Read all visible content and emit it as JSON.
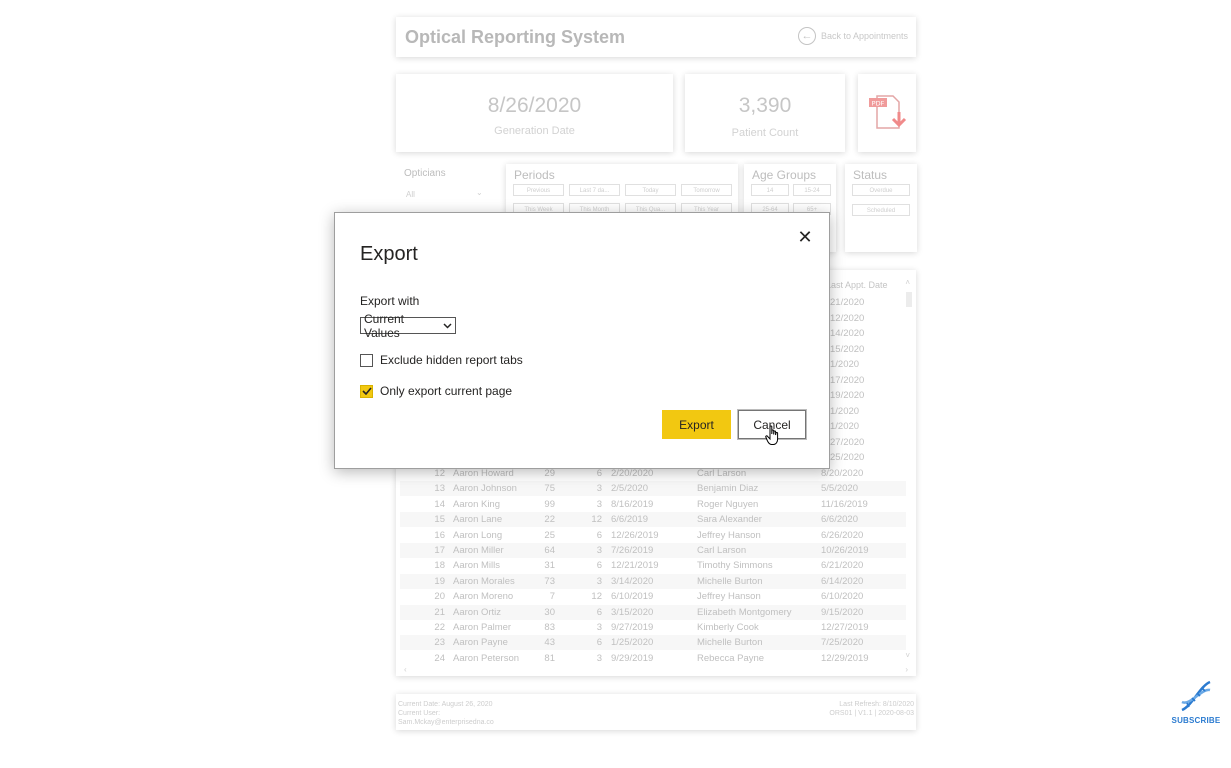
{
  "report": {
    "title": "Optical Reporting System",
    "back_label": "Back to Appointments",
    "kpi_generation": {
      "value": "8/26/2020",
      "label": "Generation Date"
    },
    "kpi_patients": {
      "value": "3,390",
      "label": "Patient Count"
    },
    "pdf_badge": "PDF",
    "slicers": {
      "opticians": {
        "title": "Opticians",
        "value": "All"
      },
      "periods": {
        "title": "Periods",
        "options": [
          "Previous",
          "Last 7 da...",
          "Today",
          "Tomorrow",
          "This Week",
          "This Month",
          "This Qua...",
          "This Year"
        ]
      },
      "age_groups": {
        "title": "Age Groups",
        "options": [
          "14",
          "15-24",
          "25-64",
          "65+"
        ]
      },
      "status": {
        "title": "Status",
        "options": [
          "Overdue",
          "Scheduled"
        ]
      }
    },
    "table": {
      "last_appt_header": "Last Appt. Date",
      "hidden_last_dates": [
        "21/2020",
        "12/2020",
        "14/2020",
        "15/2020",
        "1/2020",
        "17/2020",
        "19/2020",
        "1/2020",
        "1/2020",
        "27/2020",
        "25/2020"
      ],
      "rows": [
        {
          "id": "12",
          "name": "Aaron Howard",
          "age": "29",
          "period": "6",
          "date": "2/20/2020",
          "optician": "Carl Larson",
          "last": "8/20/2020"
        },
        {
          "id": "13",
          "name": "Aaron Johnson",
          "age": "75",
          "period": "3",
          "date": "2/5/2020",
          "optician": "Benjamin Diaz",
          "last": "5/5/2020"
        },
        {
          "id": "14",
          "name": "Aaron King",
          "age": "99",
          "period": "3",
          "date": "8/16/2019",
          "optician": "Roger Nguyen",
          "last": "11/16/2019"
        },
        {
          "id": "15",
          "name": "Aaron Lane",
          "age": "22",
          "period": "12",
          "date": "6/6/2019",
          "optician": "Sara Alexander",
          "last": "6/6/2020"
        },
        {
          "id": "16",
          "name": "Aaron Long",
          "age": "25",
          "period": "6",
          "date": "12/26/2019",
          "optician": "Jeffrey Hanson",
          "last": "6/26/2020"
        },
        {
          "id": "17",
          "name": "Aaron Miller",
          "age": "64",
          "period": "3",
          "date": "7/26/2019",
          "optician": "Carl Larson",
          "last": "10/26/2019"
        },
        {
          "id": "18",
          "name": "Aaron Mills",
          "age": "31",
          "period": "6",
          "date": "12/21/2019",
          "optician": "Timothy Simmons",
          "last": "6/21/2020"
        },
        {
          "id": "19",
          "name": "Aaron Morales",
          "age": "73",
          "period": "3",
          "date": "3/14/2020",
          "optician": "Michelle Burton",
          "last": "6/14/2020"
        },
        {
          "id": "20",
          "name": "Aaron Moreno",
          "age": "7",
          "period": "12",
          "date": "6/10/2019",
          "optician": "Jeffrey Hanson",
          "last": "6/10/2020"
        },
        {
          "id": "21",
          "name": "Aaron Ortiz",
          "age": "30",
          "period": "6",
          "date": "3/15/2020",
          "optician": "Elizabeth Montgomery",
          "last": "9/15/2020"
        },
        {
          "id": "22",
          "name": "Aaron Palmer",
          "age": "83",
          "period": "3",
          "date": "9/27/2019",
          "optician": "Kimberly Cook",
          "last": "12/27/2019"
        },
        {
          "id": "23",
          "name": "Aaron Payne",
          "age": "43",
          "period": "6",
          "date": "1/25/2020",
          "optician": "Michelle Burton",
          "last": "7/25/2020"
        },
        {
          "id": "24",
          "name": "Aaron Peterson",
          "age": "81",
          "period": "3",
          "date": "9/29/2019",
          "optician": "Rebecca Payne",
          "last": "12/29/2019"
        }
      ]
    },
    "footer": {
      "current_date": "Current Date: August 26, 2020",
      "current_user": "Current User:",
      "user_email": "Sam.Mckay@enterprisedna.co",
      "last_refresh": "Last Refresh: 8/10/2020",
      "version": "ORS01 | V1.1 | 2020-08-03"
    }
  },
  "subscribe": {
    "label": "SUBSCRIBE"
  },
  "dialog": {
    "title": "Export",
    "export_with_label": "Export with",
    "export_with_value": "Current Values",
    "exclude_hidden_label": "Exclude hidden report tabs",
    "exclude_hidden_checked": false,
    "only_current_label": "Only export current page",
    "only_current_checked": true,
    "export_button": "Export",
    "cancel_button": "Cancel",
    "close_glyph": "✕",
    "accent": "#f2c811"
  }
}
